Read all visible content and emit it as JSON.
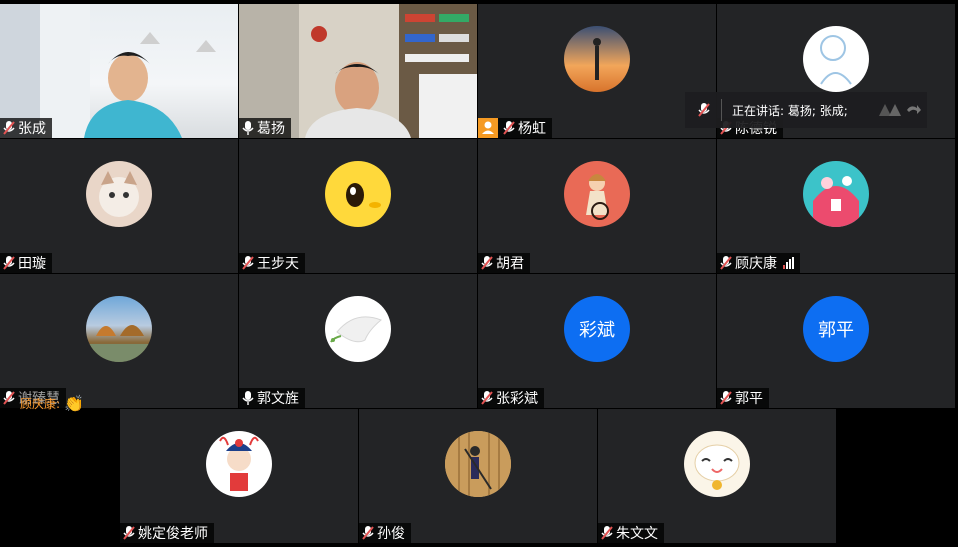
{
  "participants": [
    {
      "name": "张成",
      "mic": "muted"
    },
    {
      "name": "葛扬",
      "mic": "on"
    },
    {
      "name": "杨虹",
      "mic": "muted"
    },
    {
      "name": "陈德锐",
      "mic": "muted"
    },
    {
      "name": "田璇",
      "mic": "muted"
    },
    {
      "name": "王步天",
      "mic": "muted"
    },
    {
      "name": "胡君",
      "mic": "muted"
    },
    {
      "name": "顾庆康",
      "mic": "muted"
    },
    {
      "name": "谢臻慧",
      "mic": "muted"
    },
    {
      "name": "郭文旌",
      "mic": "on"
    },
    {
      "name": "张彩斌",
      "mic": "muted",
      "avatar_text": "彩斌"
    },
    {
      "name": "郭平",
      "mic": "muted",
      "avatar_text": "郭平"
    },
    {
      "name": "姚定俊老师",
      "mic": "muted"
    },
    {
      "name": "孙俊",
      "mic": "muted"
    },
    {
      "name": "朱文文",
      "mic": "muted"
    }
  ],
  "speaking_indicator": {
    "text": "正在讲话: 葛扬; 张成;"
  },
  "reaction": {
    "from": "顾庆康:",
    "emoji": "👏"
  },
  "colors": {
    "tile_bg": "#232426",
    "active_border": "#2ec27e",
    "avatar_text_bg": "#0d6ef2",
    "muted_mic": "#e25353",
    "reaction_text": "#ff9d2e"
  }
}
